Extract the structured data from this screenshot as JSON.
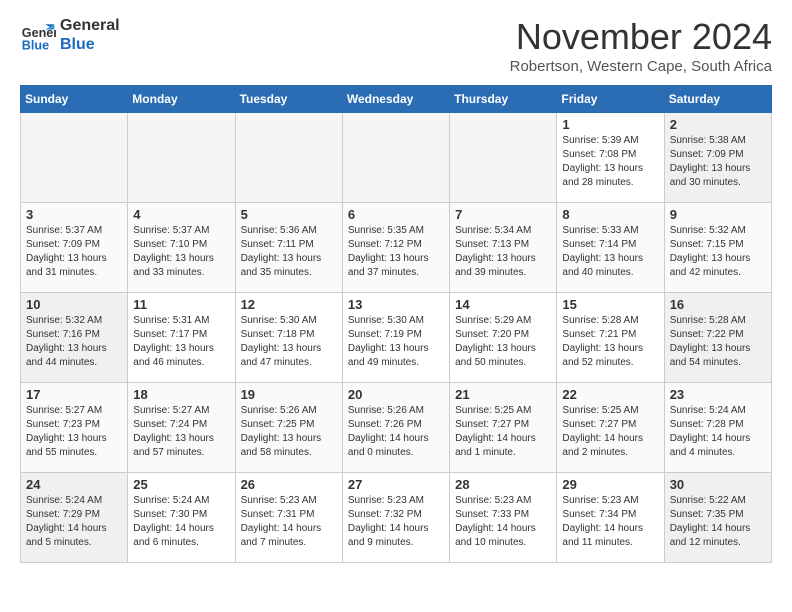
{
  "logo": {
    "line1": "General",
    "line2": "Blue"
  },
  "title": "November 2024",
  "subtitle": "Robertson, Western Cape, South Africa",
  "days_header": [
    "Sunday",
    "Monday",
    "Tuesday",
    "Wednesday",
    "Thursday",
    "Friday",
    "Saturday"
  ],
  "weeks": [
    [
      {
        "day": "",
        "info": ""
      },
      {
        "day": "",
        "info": ""
      },
      {
        "day": "",
        "info": ""
      },
      {
        "day": "",
        "info": ""
      },
      {
        "day": "",
        "info": ""
      },
      {
        "day": "1",
        "info": "Sunrise: 5:39 AM\nSunset: 7:08 PM\nDaylight: 13 hours\nand 28 minutes."
      },
      {
        "day": "2",
        "info": "Sunrise: 5:38 AM\nSunset: 7:09 PM\nDaylight: 13 hours\nand 30 minutes."
      }
    ],
    [
      {
        "day": "3",
        "info": "Sunrise: 5:37 AM\nSunset: 7:09 PM\nDaylight: 13 hours\nand 31 minutes."
      },
      {
        "day": "4",
        "info": "Sunrise: 5:37 AM\nSunset: 7:10 PM\nDaylight: 13 hours\nand 33 minutes."
      },
      {
        "day": "5",
        "info": "Sunrise: 5:36 AM\nSunset: 7:11 PM\nDaylight: 13 hours\nand 35 minutes."
      },
      {
        "day": "6",
        "info": "Sunrise: 5:35 AM\nSunset: 7:12 PM\nDaylight: 13 hours\nand 37 minutes."
      },
      {
        "day": "7",
        "info": "Sunrise: 5:34 AM\nSunset: 7:13 PM\nDaylight: 13 hours\nand 39 minutes."
      },
      {
        "day": "8",
        "info": "Sunrise: 5:33 AM\nSunset: 7:14 PM\nDaylight: 13 hours\nand 40 minutes."
      },
      {
        "day": "9",
        "info": "Sunrise: 5:32 AM\nSunset: 7:15 PM\nDaylight: 13 hours\nand 42 minutes."
      }
    ],
    [
      {
        "day": "10",
        "info": "Sunrise: 5:32 AM\nSunset: 7:16 PM\nDaylight: 13 hours\nand 44 minutes."
      },
      {
        "day": "11",
        "info": "Sunrise: 5:31 AM\nSunset: 7:17 PM\nDaylight: 13 hours\nand 46 minutes."
      },
      {
        "day": "12",
        "info": "Sunrise: 5:30 AM\nSunset: 7:18 PM\nDaylight: 13 hours\nand 47 minutes."
      },
      {
        "day": "13",
        "info": "Sunrise: 5:30 AM\nSunset: 7:19 PM\nDaylight: 13 hours\nand 49 minutes."
      },
      {
        "day": "14",
        "info": "Sunrise: 5:29 AM\nSunset: 7:20 PM\nDaylight: 13 hours\nand 50 minutes."
      },
      {
        "day": "15",
        "info": "Sunrise: 5:28 AM\nSunset: 7:21 PM\nDaylight: 13 hours\nand 52 minutes."
      },
      {
        "day": "16",
        "info": "Sunrise: 5:28 AM\nSunset: 7:22 PM\nDaylight: 13 hours\nand 54 minutes."
      }
    ],
    [
      {
        "day": "17",
        "info": "Sunrise: 5:27 AM\nSunset: 7:23 PM\nDaylight: 13 hours\nand 55 minutes."
      },
      {
        "day": "18",
        "info": "Sunrise: 5:27 AM\nSunset: 7:24 PM\nDaylight: 13 hours\nand 57 minutes."
      },
      {
        "day": "19",
        "info": "Sunrise: 5:26 AM\nSunset: 7:25 PM\nDaylight: 13 hours\nand 58 minutes."
      },
      {
        "day": "20",
        "info": "Sunrise: 5:26 AM\nSunset: 7:26 PM\nDaylight: 14 hours\nand 0 minutes."
      },
      {
        "day": "21",
        "info": "Sunrise: 5:25 AM\nSunset: 7:27 PM\nDaylight: 14 hours\nand 1 minute."
      },
      {
        "day": "22",
        "info": "Sunrise: 5:25 AM\nSunset: 7:27 PM\nDaylight: 14 hours\nand 2 minutes."
      },
      {
        "day": "23",
        "info": "Sunrise: 5:24 AM\nSunset: 7:28 PM\nDaylight: 14 hours\nand 4 minutes."
      }
    ],
    [
      {
        "day": "24",
        "info": "Sunrise: 5:24 AM\nSunset: 7:29 PM\nDaylight: 14 hours\nand 5 minutes."
      },
      {
        "day": "25",
        "info": "Sunrise: 5:24 AM\nSunset: 7:30 PM\nDaylight: 14 hours\nand 6 minutes."
      },
      {
        "day": "26",
        "info": "Sunrise: 5:23 AM\nSunset: 7:31 PM\nDaylight: 14 hours\nand 7 minutes."
      },
      {
        "day": "27",
        "info": "Sunrise: 5:23 AM\nSunset: 7:32 PM\nDaylight: 14 hours\nand 9 minutes."
      },
      {
        "day": "28",
        "info": "Sunrise: 5:23 AM\nSunset: 7:33 PM\nDaylight: 14 hours\nand 10 minutes."
      },
      {
        "day": "29",
        "info": "Sunrise: 5:23 AM\nSunset: 7:34 PM\nDaylight: 14 hours\nand 11 minutes."
      },
      {
        "day": "30",
        "info": "Sunrise: 5:22 AM\nSunset: 7:35 PM\nDaylight: 14 hours\nand 12 minutes."
      }
    ]
  ]
}
